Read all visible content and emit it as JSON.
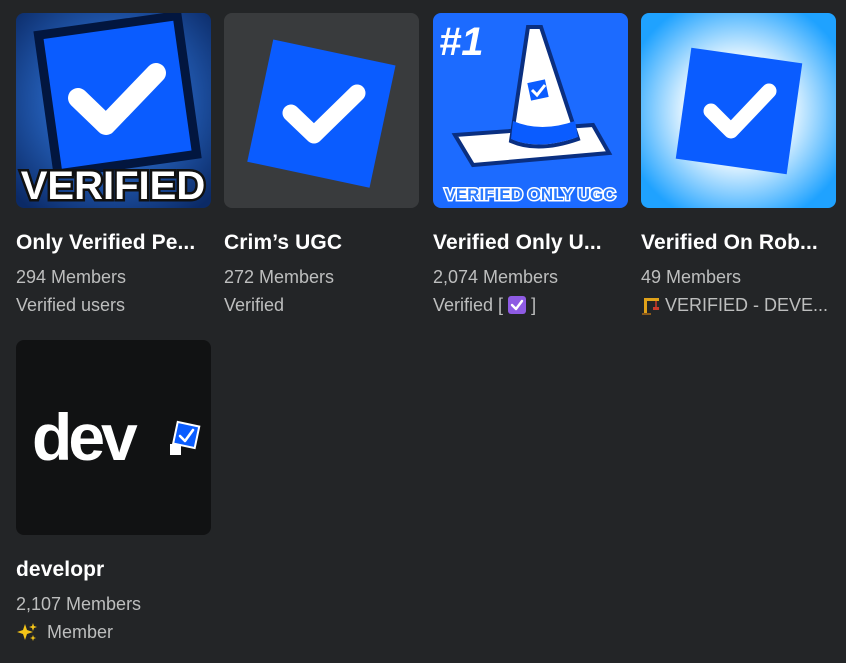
{
  "groups": [
    {
      "name": "Only Verified Pe...",
      "members": "294 Members",
      "role": "Verified users",
      "thumb_text": "VERIFIED"
    },
    {
      "name": "Crim’s UGC",
      "members": "272 Members",
      "role": "Verified"
    },
    {
      "name": "Verified Only U...",
      "members": "2,074 Members",
      "role_prefix": "Verified [",
      "role_suffix": "]",
      "thumb_badge": "#1",
      "thumb_text": "VERIFIED ONLY UGC"
    },
    {
      "name": "Verified On Rob...",
      "members": "49 Members",
      "role": "VERIFIED - DEVE..."
    },
    {
      "name": "developr",
      "members": "2,107 Members",
      "role": "Member",
      "thumb_text": "dev"
    }
  ],
  "colors": {
    "background": "#232527",
    "brand_blue": "#0a5cff",
    "muted_text": "#bdbebe"
  }
}
